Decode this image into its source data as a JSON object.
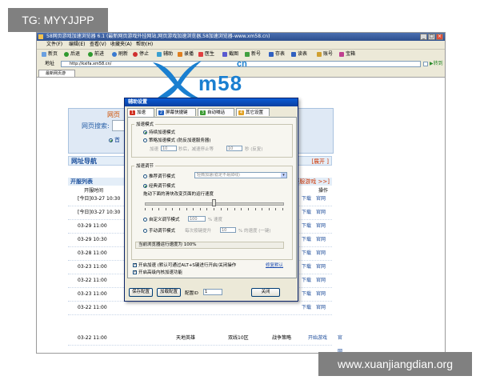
{
  "watermarks": {
    "top_left": "TG: MYYJJPP",
    "bottom_right": "www.xuanjiangdian.org"
  },
  "browser": {
    "title": "58网页游戏加速浏览器 6.1 (最新网页游戏外挂网站,网页游戏加速浏览器,58加速浏览器-www.xm58.cn)",
    "window_buttons": [
      "_",
      "□",
      "×"
    ],
    "menu": [
      "文件(F)",
      "编辑(E)",
      "查看(V)",
      "收藏夹(A)",
      "帮助(H)"
    ],
    "toolbar": [
      "新页",
      "后退",
      "前进",
      "刷新",
      "停止",
      "辅助",
      "录播",
      "医生",
      "截图",
      "新号",
      "存表",
      "读表",
      "账号",
      "宝箱"
    ],
    "address": {
      "label": "地址",
      "url": "http://kxifa.xm58.cn/",
      "go": "转到"
    },
    "tab": "最新网页游"
  },
  "page": {
    "logo_text": "m58",
    "logo_cn": "cn",
    "search_title": "网页",
    "search_label": "网页搜索:",
    "radio_label": "首",
    "nav_header": "网址导航",
    "nav_right": "[展开 ]",
    "kaifu_header": "开服列表",
    "kaifu_right": "[更多开服游戏 >>]",
    "col_time": "开服时间",
    "col_op": "操作",
    "rows": [
      {
        "time": "[今日]03-27 10:30",
        "a": "下载",
        "b": "官网"
      },
      {
        "time": "[今日]03-27 10:30",
        "a": "下载",
        "b": "官网"
      },
      {
        "time": "03-29 11:00",
        "a": "下载",
        "b": "官网"
      },
      {
        "time": "03-29 10:30",
        "a": "下载",
        "b": "官网"
      },
      {
        "time": "03-28 11:00",
        "a": "下载",
        "b": "官网"
      },
      {
        "time": "03-23 11:00",
        "a": "下载",
        "b": "官网"
      },
      {
        "time": "03-22 11:00",
        "a": "下载",
        "b": "官网"
      },
      {
        "time": "03-23 11:00",
        "a": "下载",
        "b": "官网"
      },
      {
        "time": "03-22 11:00",
        "a": "下载",
        "b": "官网"
      }
    ],
    "last_row": {
      "time": "03-22 11:00",
      "game": "天地英雄",
      "server": "双线10区",
      "type": "战争策略",
      "action": "开始游戏",
      "b": "官网"
    }
  },
  "dialog": {
    "title": "辅助设置",
    "tabs": [
      {
        "num": "1",
        "label": "加速",
        "color": "#d03020"
      },
      {
        "num": "2",
        "label": "屏幕快捷键",
        "color": "#2060c0"
      },
      {
        "num": "3",
        "label": "自动喊话",
        "color": "#3a9a30"
      },
      {
        "num": "4",
        "label": "其它设置",
        "color": "#e0a020"
      }
    ],
    "accel_mode": {
      "group": "加速模式",
      "opt1": "持续加速模式",
      "opt2": "策略加速模式 (防反加速服务器)",
      "accel_label": "加速",
      "accel_val": "10",
      "accel_unit": "秒后，减速停止等",
      "stop_val": "10",
      "stop_unit": "秒 (反复)"
    },
    "accel_adjust": {
      "group": "加速调节",
      "opt_recommend": "推荐调节模式",
      "recommend_select": "轻微加速(稳定不易掉线)",
      "opt_classic": "经典调节模式",
      "drag_hint": "拖动下面的滑块改变页面的运行速度",
      "opt_custom": "自定义调节模式",
      "custom_val": "100",
      "custom_unit": "% 速度",
      "opt_manual": "手动调节模式",
      "manual_label": "每次按键提升",
      "manual_val": "10",
      "manual_unit": "% 的速度 (一键)",
      "current_label": "当前浏览器运行速度为",
      "current_val": "100%"
    },
    "checks": {
      "c1": "开启加速 (默认可通过ALT+S键进行开启/关闭操作",
      "c1_link": "修复默认",
      "c2": "开启高级内核加速功能"
    },
    "buttons": {
      "save": "保存配置",
      "load": "加载配置",
      "config_label": "配置ID",
      "config_val": "1",
      "close": "关闭"
    },
    "speed_level": 0.5
  }
}
